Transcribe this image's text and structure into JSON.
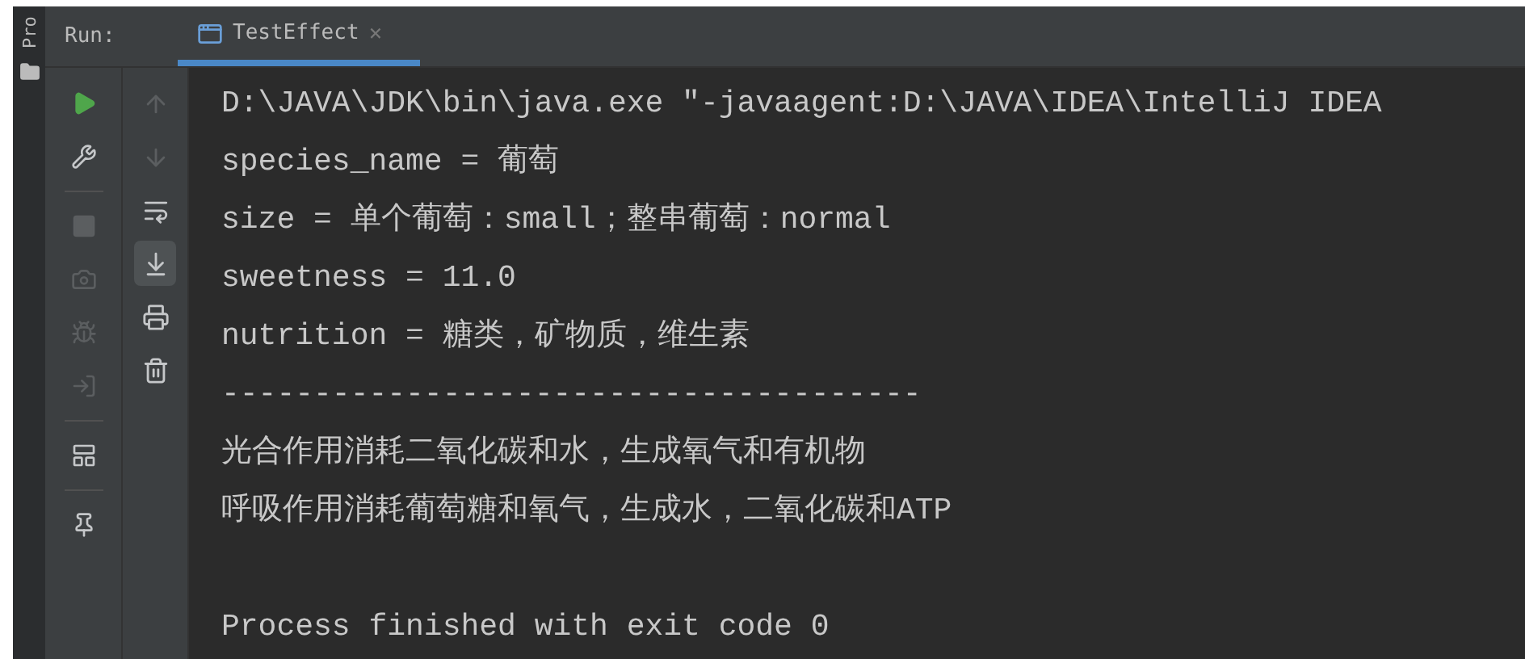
{
  "side_strip": {
    "label": "Pro"
  },
  "run_panel": {
    "label": "Run:",
    "tabs": [
      {
        "label": "TestEffect",
        "close": "×",
        "selected": true
      }
    ]
  },
  "toolbar_left": [
    {
      "disabled": false
    },
    {
      "disabled": false
    },
    {
      "disabled": true
    },
    {
      "disabled": true
    },
    {
      "disabled": true
    },
    {
      "disabled": true
    },
    {
      "disabled": false
    },
    {
      "disabled": false
    }
  ],
  "toolbar_right": [
    {
      "disabled": true,
      "selected": false
    },
    {
      "disabled": true,
      "selected": false
    },
    {
      "disabled": false,
      "selected": false
    },
    {
      "disabled": false,
      "selected": true
    },
    {
      "disabled": false,
      "selected": false
    },
    {
      "disabled": false,
      "selected": false
    }
  ],
  "console": {
    "lines": [
      "D:\\JAVA\\JDK\\bin\\java.exe \"-javaagent:D:\\JAVA\\IDEA\\IntelliJ IDEA",
      "species_name = 葡萄",
      "size = 单个葡萄：small；整串葡萄：normal",
      "sweetness = 11.0",
      "nutrition = 糖类，矿物质，维生素",
      "--------------------------------------",
      "光合作用消耗二氧化碳和水，生成氧气和有机物",
      "呼吸作用消耗葡萄糖和氧气，生成水，二氧化碳和ATP"
    ],
    "exit_message": "Process finished with exit code 0"
  }
}
